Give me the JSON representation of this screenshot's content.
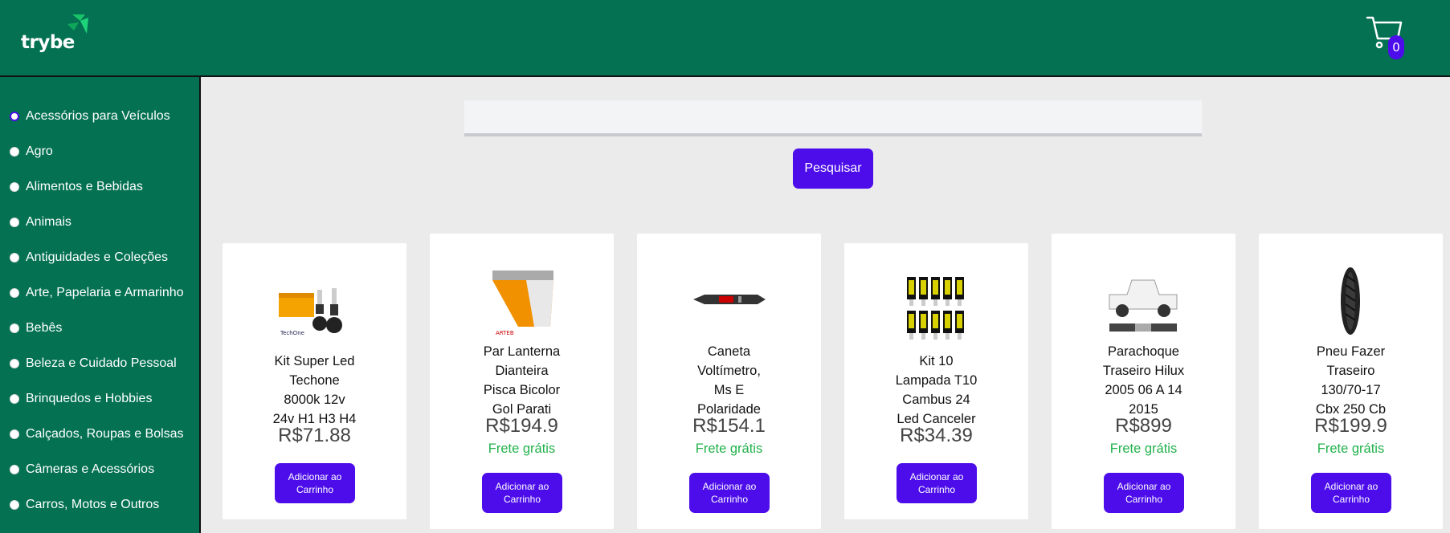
{
  "header": {
    "logo_text": "trybe",
    "cart_count": "0",
    "colors": {
      "background": "#037152",
      "accent": "#4c0dea"
    }
  },
  "sidebar": {
    "categories": [
      {
        "label": "Acessórios para Veículos",
        "selected": true
      },
      {
        "label": "Agro",
        "selected": false
      },
      {
        "label": "Alimentos e Bebidas",
        "selected": false
      },
      {
        "label": "Animais",
        "selected": false
      },
      {
        "label": "Antiguidades e Coleções",
        "selected": false
      },
      {
        "label": "Arte, Papelaria e Armarinho",
        "selected": false
      },
      {
        "label": "Bebês",
        "selected": false
      },
      {
        "label": "Beleza e Cuidado Pessoal",
        "selected": false
      },
      {
        "label": "Brinquedos e Hobbies",
        "selected": false
      },
      {
        "label": "Calçados, Roupas e Bolsas",
        "selected": false
      },
      {
        "label": "Câmeras e Acessórios",
        "selected": false
      },
      {
        "label": "Carros, Motos e Outros",
        "selected": false
      }
    ]
  },
  "search": {
    "value": "",
    "placeholder": "",
    "button_label": "Pesquisar"
  },
  "products": [
    {
      "title_lines": [
        "Kit Super Led",
        "Techone",
        "8000k 12v",
        "24v H1 H3 H4"
      ],
      "price": "R$71.88",
      "shipping": "",
      "button_label": "Adicionar ao Carrinho",
      "image": "headlight-led-kit-image"
    },
    {
      "title_lines": [
        "Par Lanterna",
        "Dianteira",
        "Pisca Bicolor",
        "Gol Parati"
      ],
      "price": "R$194.9",
      "shipping": "Frete grátis",
      "button_label": "Adicionar ao Carrinho",
      "image": "turn-signal-lamp-image"
    },
    {
      "title_lines": [
        "Caneta",
        "Voltímetro,",
        "Ms E",
        "Polaridade"
      ],
      "price": "R$154.1",
      "shipping": "Frete grátis",
      "button_label": "Adicionar ao Carrinho",
      "image": "voltmeter-pen-image"
    },
    {
      "title_lines": [
        "Kit 10",
        "Lampada T10",
        "Cambus 24",
        "Led Canceler"
      ],
      "price": "R$34.39",
      "shipping": "",
      "button_label": "Adicionar ao Carrinho",
      "image": "t10-led-bulbs-image"
    },
    {
      "title_lines": [
        "Parachoque",
        "Traseiro Hilux",
        "2005 06 A 14",
        "2015"
      ],
      "price": "R$899",
      "shipping": "Frete grátis",
      "button_label": "Adicionar ao Carrinho",
      "image": "pickup-truck-bumper-image"
    },
    {
      "title_lines": [
        "Pneu Fazer",
        "Traseiro",
        "130/70-17",
        "Cbx 250 Cb"
      ],
      "price": "R$199.9",
      "shipping": "Frete grátis",
      "button_label": "Adicionar ao Carrinho",
      "image": "motorcycle-tire-image"
    }
  ]
}
